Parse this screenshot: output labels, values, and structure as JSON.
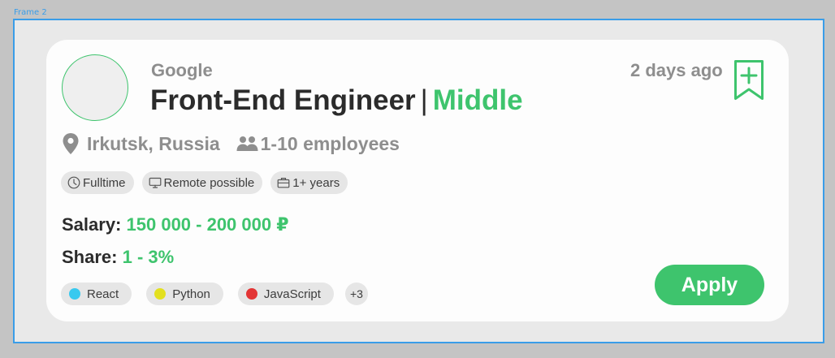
{
  "frame": {
    "label": "Frame 2"
  },
  "card": {
    "company": "Google",
    "title": "Front-End Engineer",
    "separator": "|",
    "level": "Middle",
    "posted": "2 days ago",
    "location": "Irkutsk, Russia",
    "company_size": "1-10 employees",
    "tags": [
      {
        "label": "Fulltime",
        "icon": "clock-icon"
      },
      {
        "label": "Remote possible",
        "icon": "monitor-icon"
      },
      {
        "label": "1+ years",
        "icon": "briefcase-icon"
      }
    ],
    "salary_label": "Salary:",
    "salary_value": "150 000 - 200 000 ₽",
    "share_label": "Share:",
    "share_value": "1 - 3%",
    "skills": [
      {
        "label": "React",
        "color": "#38c9ef"
      },
      {
        "label": "Python",
        "color": "#e3e01f"
      },
      {
        "label": "JavaScript",
        "color": "#e33535"
      }
    ],
    "more_skills": "+3",
    "apply_label": "Apply"
  },
  "colors": {
    "accent": "#3ec46d",
    "frame_border": "#3a9de8",
    "muted_text": "#8e8e8e",
    "dark_text": "#2b2b2b"
  }
}
